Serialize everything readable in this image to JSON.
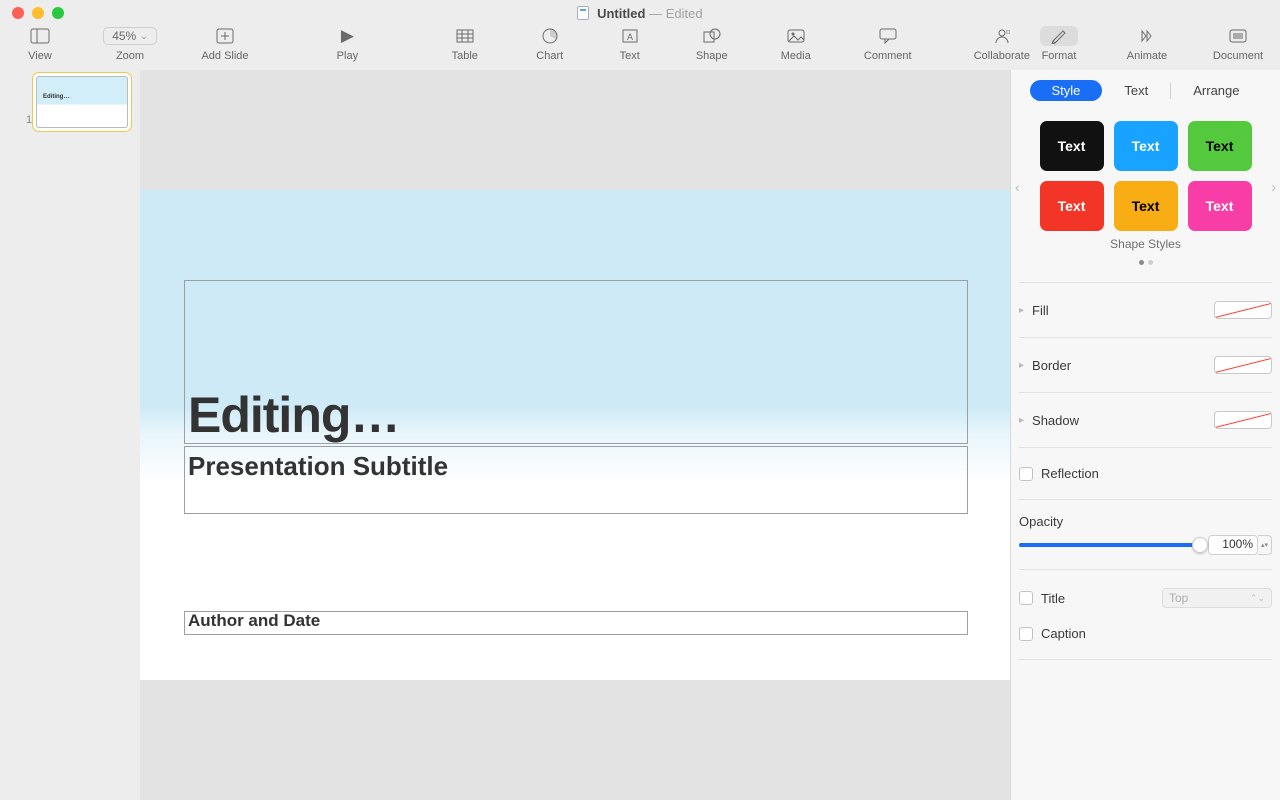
{
  "window": {
    "doc_name": "Untitled",
    "edited_suffix": "— Edited"
  },
  "toolbar": {
    "view": "View",
    "zoom_label": "Zoom",
    "zoom_value": "45%",
    "add_slide": "Add Slide",
    "play": "Play",
    "table": "Table",
    "chart": "Chart",
    "text": "Text",
    "shape": "Shape",
    "media": "Media",
    "comment": "Comment",
    "collaborate": "Collaborate",
    "format": "Format",
    "animate": "Animate",
    "document": "Document"
  },
  "sidebar": {
    "slide_number": "1",
    "thumb_text": "Editing…"
  },
  "slide": {
    "title": "Editing…",
    "subtitle": "Presentation Subtitle",
    "author": "Author and Date"
  },
  "inspector": {
    "tabs": {
      "style": "Style",
      "text": "Text",
      "arrange": "Arrange"
    },
    "swatch_label": "Text",
    "shape_styles_caption": "Shape Styles",
    "fill": "Fill",
    "border": "Border",
    "shadow": "Shadow",
    "reflection": "Reflection",
    "opacity": "Opacity",
    "opacity_value": "100%",
    "title": "Title",
    "caption": "Caption",
    "title_position": "Top"
  }
}
